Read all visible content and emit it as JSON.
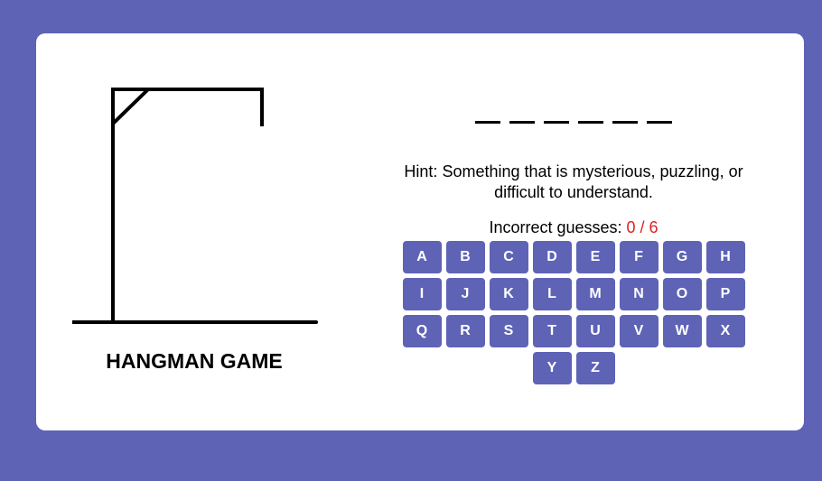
{
  "game": {
    "title": "HANGMAN GAME",
    "word_length": 6,
    "hint_label": "Hint:",
    "hint_text": "Something that is mysterious, puzzling, or difficult to understand.",
    "guesses_label": "Incorrect guesses:",
    "guesses_count": "0 / 6"
  },
  "keyboard": {
    "letters": [
      "A",
      "B",
      "C",
      "D",
      "E",
      "F",
      "G",
      "H",
      "I",
      "J",
      "K",
      "L",
      "M",
      "N",
      "O",
      "P",
      "Q",
      "R",
      "S",
      "T",
      "U",
      "V",
      "W",
      "X",
      "Y",
      "Z"
    ]
  },
  "colors": {
    "background": "#5e63b6",
    "card": "#ffffff",
    "key": "#5e63b6",
    "count": "#e02020"
  }
}
